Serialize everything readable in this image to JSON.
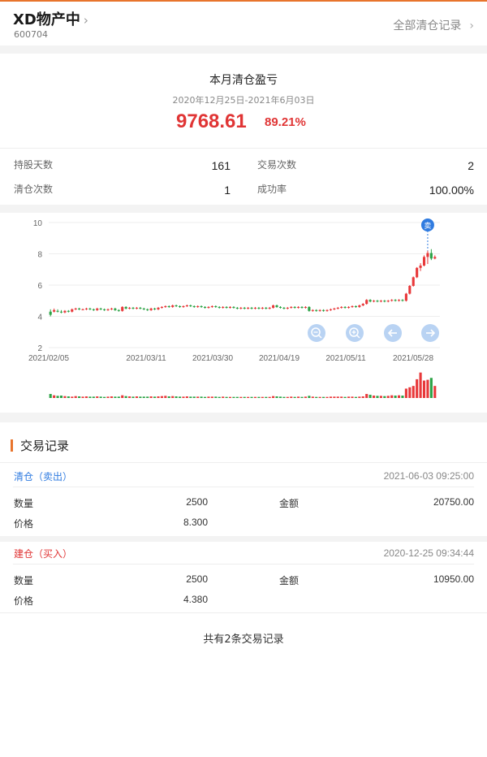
{
  "header": {
    "stock_name": "XD物产中",
    "chevron": "›",
    "stock_code": "600704",
    "all_records_link": "全部清仓记录",
    "link_chevron": "›"
  },
  "summary": {
    "title": "本月清仓盈亏",
    "date_range": "2020年12月25日-2021年6月03日",
    "profit": "9768.61",
    "profit_pct": "89.21%",
    "stats": {
      "hold_days_label": "持股天数",
      "hold_days": "161",
      "trade_count_label": "交易次数",
      "trade_count": "2",
      "clear_count_label": "清仓次数",
      "clear_count": "1",
      "success_rate_label": "成功率",
      "success_rate": "100.00%"
    }
  },
  "chart_data": {
    "type": "candlestick",
    "y_ticks": [
      "10",
      "8",
      "6",
      "4",
      "2"
    ],
    "ylim": [
      2,
      10
    ],
    "x_ticks": [
      "2021/02/05",
      "2021/03/11",
      "2021/03/30",
      "2021/04/19",
      "2021/05/11",
      "2021/05/28"
    ],
    "sell_marker": "卖",
    "colors": {
      "up": "#e8383a",
      "down": "#2ba245",
      "marker": "#2f7be0",
      "tool": "#b9d3f3"
    },
    "tool_icons": [
      "zoom-out-icon",
      "zoom-in-icon",
      "arrow-left-icon",
      "arrow-right-icon"
    ],
    "candles": [
      [
        4.3,
        4.1,
        4.45,
        4.0
      ],
      [
        4.3,
        4.4,
        4.5,
        4.25
      ],
      [
        4.35,
        4.3,
        4.45,
        4.25
      ],
      [
        4.3,
        4.25,
        4.4,
        4.2
      ],
      [
        4.25,
        4.35,
        4.4,
        4.2
      ],
      [
        4.35,
        4.3,
        4.4,
        4.25
      ],
      [
        4.3,
        4.45,
        4.5,
        4.25
      ],
      [
        4.45,
        4.5,
        4.55,
        4.4
      ],
      [
        4.5,
        4.45,
        4.55,
        4.4
      ],
      [
        4.45,
        4.45,
        4.5,
        4.4
      ],
      [
        4.45,
        4.5,
        4.55,
        4.4
      ],
      [
        4.5,
        4.45,
        4.55,
        4.4
      ],
      [
        4.45,
        4.4,
        4.5,
        4.35
      ],
      [
        4.4,
        4.5,
        4.55,
        4.35
      ],
      [
        4.5,
        4.45,
        4.55,
        4.4
      ],
      [
        4.45,
        4.4,
        4.5,
        4.35
      ],
      [
        4.4,
        4.45,
        4.5,
        4.35
      ],
      [
        4.45,
        4.5,
        4.55,
        4.4
      ],
      [
        4.5,
        4.4,
        4.55,
        4.35
      ],
      [
        4.4,
        4.35,
        4.45,
        4.3
      ],
      [
        4.35,
        4.6,
        4.65,
        4.3
      ],
      [
        4.6,
        4.5,
        4.65,
        4.45
      ],
      [
        4.5,
        4.55,
        4.6,
        4.45
      ],
      [
        4.55,
        4.5,
        4.6,
        4.45
      ],
      [
        4.5,
        4.55,
        4.6,
        4.45
      ],
      [
        4.55,
        4.5,
        4.6,
        4.45
      ],
      [
        4.5,
        4.45,
        4.55,
        4.4
      ],
      [
        4.45,
        4.4,
        4.5,
        4.35
      ],
      [
        4.4,
        4.5,
        4.55,
        4.35
      ],
      [
        4.5,
        4.45,
        4.55,
        4.4
      ],
      [
        4.45,
        4.55,
        4.6,
        4.4
      ],
      [
        4.55,
        4.6,
        4.65,
        4.5
      ],
      [
        4.6,
        4.65,
        4.7,
        4.55
      ],
      [
        4.65,
        4.6,
        4.7,
        4.55
      ],
      [
        4.6,
        4.7,
        4.75,
        4.55
      ],
      [
        4.7,
        4.65,
        4.75,
        4.6
      ],
      [
        4.65,
        4.6,
        4.7,
        4.55
      ],
      [
        4.6,
        4.65,
        4.7,
        4.55
      ],
      [
        4.65,
        4.7,
        4.75,
        4.6
      ],
      [
        4.7,
        4.65,
        4.75,
        4.6
      ],
      [
        4.65,
        4.6,
        4.7,
        4.55
      ],
      [
        4.6,
        4.65,
        4.7,
        4.55
      ],
      [
        4.65,
        4.6,
        4.7,
        4.55
      ],
      [
        4.6,
        4.55,
        4.65,
        4.5
      ],
      [
        4.55,
        4.6,
        4.65,
        4.5
      ],
      [
        4.6,
        4.65,
        4.7,
        4.55
      ],
      [
        4.65,
        4.6,
        4.7,
        4.55
      ],
      [
        4.6,
        4.55,
        4.65,
        4.5
      ],
      [
        4.55,
        4.6,
        4.65,
        4.5
      ],
      [
        4.6,
        4.55,
        4.65,
        4.5
      ],
      [
        4.55,
        4.6,
        4.65,
        4.5
      ],
      [
        4.6,
        4.55,
        4.65,
        4.5
      ],
      [
        4.55,
        4.5,
        4.6,
        4.45
      ],
      [
        4.5,
        4.55,
        4.6,
        4.45
      ],
      [
        4.55,
        4.5,
        4.6,
        4.45
      ],
      [
        4.5,
        4.55,
        4.6,
        4.45
      ],
      [
        4.55,
        4.5,
        4.6,
        4.45
      ],
      [
        4.5,
        4.55,
        4.6,
        4.45
      ],
      [
        4.55,
        4.5,
        4.6,
        4.45
      ],
      [
        4.5,
        4.55,
        4.6,
        4.45
      ],
      [
        4.55,
        4.5,
        4.6,
        4.45
      ],
      [
        4.5,
        4.55,
        4.6,
        4.45
      ],
      [
        4.55,
        4.7,
        4.75,
        4.5
      ],
      [
        4.7,
        4.6,
        4.75,
        4.55
      ],
      [
        4.6,
        4.55,
        4.65,
        4.5
      ],
      [
        4.55,
        4.5,
        4.6,
        4.45
      ],
      [
        4.5,
        4.55,
        4.6,
        4.45
      ],
      [
        4.55,
        4.6,
        4.65,
        4.5
      ],
      [
        4.6,
        4.55,
        4.65,
        4.5
      ],
      [
        4.55,
        4.6,
        4.65,
        4.5
      ],
      [
        4.6,
        4.55,
        4.65,
        4.5
      ],
      [
        4.55,
        4.6,
        4.65,
        4.5
      ],
      [
        4.6,
        4.35,
        4.65,
        4.3
      ],
      [
        4.35,
        4.4,
        4.45,
        4.3
      ],
      [
        4.4,
        4.35,
        4.45,
        4.3
      ],
      [
        4.35,
        4.4,
        4.45,
        4.3
      ],
      [
        4.4,
        4.35,
        4.45,
        4.3
      ],
      [
        4.35,
        4.4,
        4.45,
        4.3
      ],
      [
        4.4,
        4.45,
        4.5,
        4.35
      ],
      [
        4.45,
        4.5,
        4.55,
        4.4
      ],
      [
        4.5,
        4.55,
        4.6,
        4.45
      ],
      [
        4.55,
        4.6,
        4.65,
        4.5
      ],
      [
        4.6,
        4.55,
        4.65,
        4.5
      ],
      [
        4.55,
        4.6,
        4.65,
        4.5
      ],
      [
        4.6,
        4.65,
        4.7,
        4.55
      ],
      [
        4.65,
        4.6,
        4.7,
        4.55
      ],
      [
        4.6,
        4.7,
        4.75,
        4.55
      ],
      [
        4.7,
        4.8,
        4.85,
        4.65
      ],
      [
        4.8,
        5.05,
        5.1,
        4.75
      ],
      [
        5.05,
        4.95,
        5.1,
        4.9
      ],
      [
        4.95,
        5.0,
        5.05,
        4.9
      ],
      [
        5.0,
        4.95,
        5.05,
        4.9
      ],
      [
        4.95,
        5.0,
        5.05,
        4.9
      ],
      [
        5.0,
        4.95,
        5.05,
        4.9
      ],
      [
        4.95,
        5.0,
        5.05,
        4.9
      ],
      [
        5.0,
        5.05,
        5.1,
        4.95
      ],
      [
        5.05,
        5.0,
        5.1,
        4.95
      ],
      [
        5.0,
        5.05,
        5.1,
        4.95
      ],
      [
        5.05,
        5.0,
        5.1,
        4.95
      ],
      [
        5.0,
        5.45,
        5.5,
        4.95
      ],
      [
        5.45,
        5.95,
        6.0,
        5.4
      ],
      [
        5.95,
        6.5,
        6.55,
        5.9
      ],
      [
        6.5,
        7.1,
        7.15,
        6.45
      ],
      [
        7.1,
        7.25,
        7.4,
        6.9
      ],
      [
        7.25,
        7.8,
        7.9,
        7.2
      ],
      [
        7.8,
        8.05,
        8.2,
        7.35
      ],
      [
        8.05,
        7.7,
        8.3,
        7.6
      ],
      [
        7.7,
        7.8,
        7.9,
        7.65
      ]
    ],
    "volumes": [
      0.15,
      0.1,
      0.08,
      0.09,
      0.07,
      0.06,
      0.05,
      0.07,
      0.06,
      0.05,
      0.06,
      0.05,
      0.05,
      0.06,
      0.05,
      0.04,
      0.05,
      0.06,
      0.05,
      0.05,
      0.1,
      0.07,
      0.06,
      0.05,
      0.06,
      0.05,
      0.05,
      0.05,
      0.06,
      0.05,
      0.06,
      0.07,
      0.08,
      0.06,
      0.07,
      0.06,
      0.05,
      0.05,
      0.06,
      0.05,
      0.05,
      0.05,
      0.05,
      0.04,
      0.05,
      0.05,
      0.05,
      0.04,
      0.05,
      0.04,
      0.04,
      0.04,
      0.04,
      0.04,
      0.04,
      0.04,
      0.04,
      0.04,
      0.04,
      0.04,
      0.04,
      0.04,
      0.07,
      0.06,
      0.05,
      0.04,
      0.04,
      0.05,
      0.04,
      0.05,
      0.04,
      0.05,
      0.08,
      0.05,
      0.04,
      0.04,
      0.04,
      0.04,
      0.05,
      0.05,
      0.05,
      0.05,
      0.04,
      0.05,
      0.05,
      0.04,
      0.05,
      0.06,
      0.15,
      0.12,
      0.09,
      0.08,
      0.08,
      0.07,
      0.08,
      0.1,
      0.09,
      0.1,
      0.09,
      0.35,
      0.4,
      0.45,
      0.7,
      0.95,
      0.65,
      0.68,
      0.75,
      0.45
    ]
  },
  "trades": {
    "section_title": "交易记录",
    "records": [
      {
        "type": "清仓（卖出）",
        "type_color": "#2f7be0",
        "time": "2021-06-03 09:25:00",
        "qty_label": "数量",
        "qty": "2500",
        "amount_label": "金额",
        "amount": "20750.00",
        "price_label": "价格",
        "price": "8.300"
      },
      {
        "type": "建仓（买入）",
        "type_color": "#e03535",
        "time": "2020-12-25 09:34:44",
        "qty_label": "数量",
        "qty": "2500",
        "amount_label": "金额",
        "amount": "10950.00",
        "price_label": "价格",
        "price": "4.380"
      }
    ],
    "footer": "共有2条交易记录"
  }
}
